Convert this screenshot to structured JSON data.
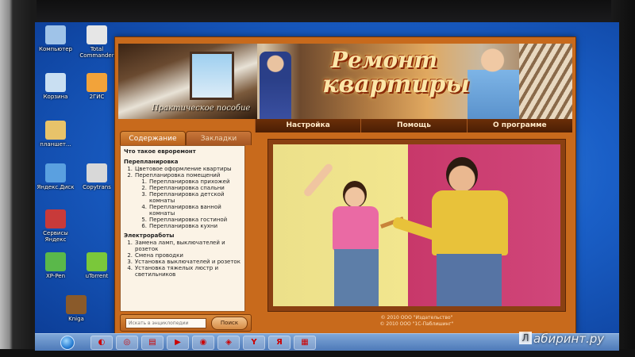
{
  "desktop": {
    "icons": [
      {
        "label": "Компьютер",
        "color": "#9fc3e8"
      },
      {
        "label": "Total Commander",
        "color": "#e6e6e6"
      },
      {
        "label": "Корзина",
        "color": "#c9dff2"
      },
      {
        "label": "2ГИС",
        "color": "#f2a33a"
      },
      {
        "label": "планшет...",
        "color": "#e8c36a"
      },
      {
        "label": "Яндекс.Диск",
        "color": "#5aa0e0"
      },
      {
        "label": "Copytrans",
        "color": "#d8d8d8"
      },
      {
        "label": "Cервисы Яндекс",
        "color": "#c83a3a"
      },
      {
        "label": "XP-Pen",
        "color": "#5ab84a"
      },
      {
        "label": "uTorrent",
        "color": "#7ac83a"
      },
      {
        "label": "Kniga",
        "color": "#8a5a2a"
      }
    ]
  },
  "app": {
    "logo_line1": "Ремонт",
    "logo_line2": "квартиры",
    "subtitle": "Практическое пособие",
    "menu": [
      "Настройка",
      "Помощь",
      "О программе"
    ],
    "tabs": [
      "Содержание",
      "Закладки"
    ],
    "toc": {
      "intro": "Что такое евроремонт",
      "sections": [
        {
          "title": "Перепланировка",
          "items": [
            {
              "n": "1.",
              "text": "Цветовое оформление квартиры",
              "children": []
            },
            {
              "n": "2.",
              "text": "Перепланировка помещений",
              "children": [
                {
                  "n": "1.",
                  "text": "Перепланировка прихожей"
                },
                {
                  "n": "2.",
                  "text": "Перепланировка спальни"
                },
                {
                  "n": "3.",
                  "text": "Перепланировка детской комнаты"
                },
                {
                  "n": "4.",
                  "text": "Перепланировка ванной комнаты"
                },
                {
                  "n": "5.",
                  "text": "Перепланировка гостиной"
                },
                {
                  "n": "6.",
                  "text": "Перепланировка кухни"
                }
              ]
            }
          ]
        },
        {
          "title": "Электроработы",
          "items": [
            {
              "n": "1.",
              "text": "Замена ламп, выключателей и розеток",
              "children": []
            },
            {
              "n": "2.",
              "text": "Смена проводки",
              "children": []
            },
            {
              "n": "3.",
              "text": "Установка выключателей и розеток",
              "children": []
            },
            {
              "n": "4.",
              "text": "Установка тяжелых люстр и светильников",
              "children": []
            }
          ]
        }
      ]
    },
    "search": {
      "placeholder": "Искать в энциклопедии",
      "button": "Поиск"
    },
    "copyright": [
      "© 2010 ООО \"Издательство\"",
      "© 2010 ООО \"1С-Паблишинг\""
    ]
  },
  "taskbar": {
    "buttons": [
      "◐",
      "◎",
      "▤",
      "▶",
      "◉",
      "◈",
      "Y",
      "Я",
      "▦"
    ]
  },
  "watermark": {
    "box": "Л",
    "text": "абиринт.ру"
  }
}
